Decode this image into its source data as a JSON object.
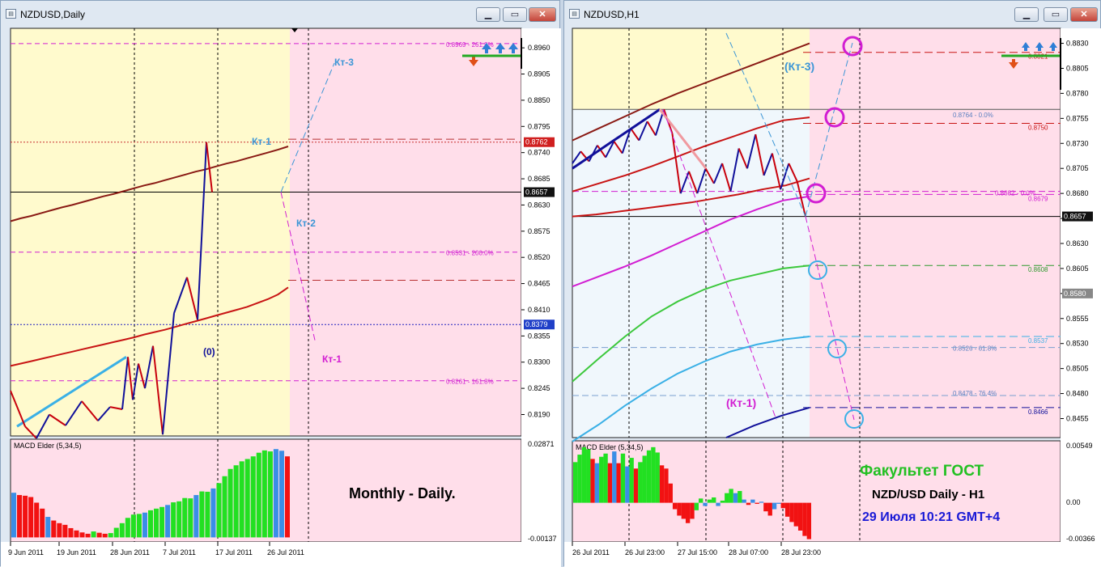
{
  "colors": {
    "bg_yellow": "#fffacd",
    "bg_pink": "#ffdeea",
    "bg_light": "#f0f7fc",
    "price_blue": "#10109a",
    "price_red": "#c8000c",
    "env_dark": "#8a1a14",
    "env_red": "#c81414",
    "magenta": "#d21ed2",
    "cyan": "#3ab0e6",
    "green": "#3cc83c",
    "forecast_blue": "#3c96d6",
    "macd_green": "#22e022",
    "macd_red": "#f21212",
    "macd_blue": "#3a8ee6"
  },
  "left": {
    "title": "NZDUSD,Daily",
    "macd_label": "MACD Elder (5,34,5)",
    "macd_top": "0.02871",
    "macd_bottom": "-0.00137",
    "overlay_text": "Monthly - Daily.",
    "annotations": [
      "Кт-3",
      "Кт-1",
      "Кт-2",
      "Кт-1",
      "(0)"
    ],
    "level_labels": [
      "0.8969 - 261.8%",
      "0.8531 - 200.0%",
      "0.8261 - 161.8%"
    ],
    "price_badges": [
      "0.8762",
      "0.8657",
      "0.8379"
    ],
    "chart_data": {
      "type": "line",
      "title": "NZDUSD,Daily",
      "ylim": [
        0.8145,
        0.9001
      ],
      "y_ticks": [
        "0.8960",
        "0.8905",
        "0.8850",
        "0.8795",
        "0.8740",
        "0.8685",
        "0.8630",
        "0.8575",
        "0.8520",
        "0.8465",
        "0.8410",
        "0.8355",
        "0.8300",
        "0.8245",
        "0.8190"
      ],
      "x_ticks": [
        "9 Jun 2011",
        "19 Jun 2011",
        "28 Jun 2011",
        "7 Jul 2011",
        "17 Jul 2011",
        "26 Jul 2011"
      ],
      "series": [
        {
          "values": [
            0.824,
            0.8215,
            0.8165,
            0.814,
            0.819,
            0.8167,
            0.8218,
            0.8177,
            0.8206,
            0.8201,
            0.8311,
            0.8221,
            0.8297,
            0.8245,
            0.8334,
            0.8148,
            0.8403,
            0.8478,
            0.8389,
            0.8762,
            0.8657
          ]
        },
        {
          "values": [
            0.8596,
            0.8602,
            0.8607,
            0.8613,
            0.8619,
            0.8625,
            0.863,
            0.8636,
            0.8642,
            0.8648,
            0.8653,
            0.8659,
            0.8665,
            0.8671,
            0.8676,
            0.8682,
            0.8688,
            0.8694,
            0.87,
            0.8705,
            0.8711,
            0.8717,
            0.8722,
            0.8728,
            0.8734,
            0.874,
            0.8746,
            0.8753
          ]
        },
        {
          "values": [
            0.8292,
            0.8297,
            0.8302,
            0.8307,
            0.8312,
            0.8317,
            0.8322,
            0.8327,
            0.8332,
            0.8337,
            0.8342,
            0.8347,
            0.8352,
            0.8358,
            0.8363,
            0.8368,
            0.8374,
            0.838,
            0.8386,
            0.8392,
            0.8398,
            0.8404,
            0.841,
            0.8416,
            0.8424,
            0.8432,
            0.8442,
            0.8457
          ]
        }
      ],
      "macd": {
        "values": [
          0.0135,
          0.0128,
          0.0126,
          0.0122,
          0.0105,
          0.0087,
          0.0062,
          0.0051,
          0.0043,
          0.0038,
          0.0028,
          0.0021,
          0.0015,
          0.0011,
          0.0018,
          0.0014,
          0.0011,
          0.0013,
          0.0029,
          0.0043,
          0.0059,
          0.0069,
          0.0071,
          0.0075,
          0.0082,
          0.0087,
          0.0092,
          0.0098,
          0.0106,
          0.0109,
          0.0119,
          0.0118,
          0.0128,
          0.0139,
          0.0138,
          0.0148,
          0.0164,
          0.0185,
          0.0207,
          0.0218,
          0.023,
          0.0237,
          0.0245,
          0.0256,
          0.0263,
          0.026,
          0.0267,
          0.0262,
          0.0245
        ],
        "colors": [
          "b",
          "r",
          "r",
          "r",
          "r",
          "r",
          "b",
          "r",
          "r",
          "r",
          "r",
          "r",
          "r",
          "r",
          "g",
          "r",
          "r",
          "g",
          "g",
          "g",
          "g",
          "g",
          "g",
          "b",
          "g",
          "g",
          "g",
          "b",
          "g",
          "g",
          "g",
          "g",
          "b",
          "g",
          "g",
          "b",
          "g",
          "g",
          "g",
          "g",
          "g",
          "g",
          "g",
          "g",
          "g",
          "g",
          "b",
          "b",
          "r"
        ],
        "ylim": [
          -0.00137,
          0.02871
        ]
      }
    }
  },
  "right": {
    "title": "NZDUSD,H1",
    "macd_label": "MACD Elder (5,34,5)",
    "macd_top": "0.00549",
    "macd_zero": "0.00",
    "macd_bottom": "-0.00366",
    "overlay_title": "Факультет ГОСТ",
    "overlay_pair": "NZD/USD Daily - H1",
    "overlay_date": "29 Июля 10:21 GMT+4",
    "annotations": [
      "(Кт-3)",
      "(Кт-1)"
    ],
    "level_labels": [
      "0.8764 - 0.0%",
      "0.8682 - 0.0%",
      "0.8526 - 61.8%",
      "0.8478 - 76.4%"
    ],
    "value_labels": [
      "0.8821",
      "0.8750",
      "0.8679",
      "0.8608",
      "0.8537",
      "0.8466"
    ],
    "price_badges": [
      "0.8657",
      "0.8580"
    ],
    "chart_data": {
      "type": "line",
      "title": "NZDUSD,H1",
      "ylim": [
        0.8436,
        0.8845
      ],
      "y_ticks": [
        "0.8830",
        "0.8805",
        "0.8780",
        "0.8755",
        "0.8730",
        "0.8705",
        "0.8680",
        "0.8655",
        "0.8630",
        "0.8605",
        "0.8580",
        "0.8555",
        "0.8530",
        "0.8505",
        "0.8480",
        "0.8455"
      ],
      "x_ticks": [
        "26 Jul 2011",
        "26 Jul 23:00",
        "27 Jul 15:00",
        "28 Jul 07:00",
        "28 Jul 23:00"
      ],
      "series": [
        {
          "values": [
            0.871,
            0.8722,
            0.8712,
            0.8728,
            0.8716,
            0.8732,
            0.872,
            0.8745,
            0.8733,
            0.8752,
            0.8738,
            0.8764,
            0.874,
            0.868,
            0.8702,
            0.868,
            0.8705,
            0.869,
            0.871,
            0.8682,
            0.8725,
            0.8705,
            0.8739,
            0.8698,
            0.872,
            0.8684,
            0.871,
            0.8692,
            0.8657
          ]
        },
        {
          "values": [
            0.8733,
            0.8745,
            0.8757,
            0.8769,
            0.878,
            0.879,
            0.88,
            0.881,
            0.882,
            0.883
          ]
        },
        {
          "values": [
            0.8682,
            0.869,
            0.8698,
            0.8707,
            0.8717,
            0.8727,
            0.8736,
            0.8745,
            0.8753,
            0.8756
          ]
        },
        {
          "values": [
            0.8657,
            0.8659,
            0.8662,
            0.8665,
            0.8668,
            0.8671,
            0.8675,
            0.8679,
            0.8684,
            0.8688,
            0.8695
          ]
        },
        {
          "values": [
            0.8587,
            0.8597,
            0.8607,
            0.8618,
            0.863,
            0.8642,
            0.8654,
            0.8664,
            0.8673,
            0.8677
          ]
        },
        {
          "values": [
            0.8492,
            0.8515,
            0.8537,
            0.8557,
            0.8572,
            0.8584,
            0.8593,
            0.8599,
            0.8605,
            0.8608
          ]
        },
        {
          "values": [
            0.8432,
            0.8449,
            0.8468,
            0.8485,
            0.85,
            0.8512,
            0.8522,
            0.8529,
            0.8534,
            0.8537
          ]
        },
        {
          "values": [
            0.8436,
            0.8448,
            0.8458,
            0.8466
          ]
        }
      ],
      "macd": {
        "values": [
          0.0038,
          0.0045,
          0.0052,
          0.005,
          0.0041,
          0.0037,
          0.0043,
          0.0046,
          0.0037,
          0.0048,
          0.0037,
          0.0046,
          0.0034,
          0.0042,
          0.0032,
          0.0038,
          0.0044,
          0.0049,
          0.0052,
          0.0047,
          0.0035,
          0.0032,
          0.0018,
          -0.0006,
          -0.0012,
          -0.0015,
          -0.0019,
          -0.0015,
          -0.0007,
          0.0004,
          -0.0003,
          0.0003,
          0.0005,
          -0.0003,
          0.0002,
          0.0009,
          0.0013,
          0.0009,
          0.0011,
          0.0003,
          -0.0002,
          0.0003,
          -0.0001,
          0.0001,
          -0.0008,
          -0.0012,
          -0.0006,
          -0.0001,
          -0.0005,
          -0.0013,
          -0.0018,
          -0.0022,
          -0.0026,
          -0.0031,
          -0.0034
        ],
        "colors": [
          "g",
          "g",
          "g",
          "g",
          "r",
          "b",
          "g",
          "g",
          "r",
          "b",
          "r",
          "g",
          "b",
          "g",
          "r",
          "g",
          "g",
          "g",
          "g",
          "g",
          "r",
          "r",
          "r",
          "r",
          "r",
          "r",
          "r",
          "r",
          "g",
          "g",
          "b",
          "g",
          "g",
          "b",
          "g",
          "g",
          "g",
          "b",
          "g",
          "b",
          "r",
          "b",
          "r",
          "b",
          "r",
          "r",
          "b",
          "b",
          "r",
          "r",
          "r",
          "r",
          "r",
          "r",
          "r"
        ],
        "ylim": [
          -0.00366,
          0.00549
        ]
      }
    }
  }
}
